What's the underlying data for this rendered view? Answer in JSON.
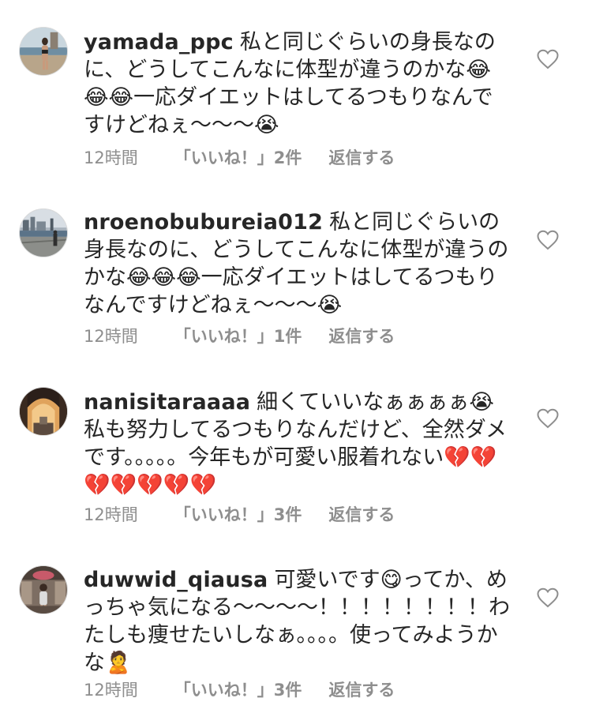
{
  "comments": [
    {
      "username": "yamada_ppc",
      "text": "私と同じぐらいの身長なのに、どうしてこんなに体型が違うのかな😂😂😂一応ダイエットはしてるつもりなんですけどねぇ〜〜〜😭",
      "time": "12時間",
      "likes": "「いいね！」2件",
      "reply": "返信する",
      "avatar_icon": "avatar-photo-beach"
    },
    {
      "username": "nroenobubureia012",
      "text": "私と同じぐらいの身長なのに、どうしてこんなに体型が違うのかな😂😂😂一応ダイエットはしてるつもりなんですけどねぇ〜〜〜😭",
      "time": "12時間",
      "likes": "「いいね！」1件",
      "reply": "返信する",
      "avatar_icon": "avatar-photo-harbor"
    },
    {
      "username": "nanisitaraaaa",
      "text": "細くていいなぁぁぁぁ😭私も努力してるつもりなんだけど、全然ダメです。。。。。今年もが可愛い服着れない💔💔💔💔💔💔💔",
      "time": "12時間",
      "likes": "「いいね！」3件",
      "reply": "返信する",
      "avatar_icon": "avatar-photo-archway"
    },
    {
      "username": "duwwid_qiausa",
      "text": "可愛いです😋ってか、めっちゃ気になる〜〜〜〜！！！！！！！！わたしも痩せたいしなぁ。。。。使ってみようかな🙎",
      "time": "12時間",
      "likes": "「いいね！」3件",
      "reply": "返信する",
      "avatar_icon": "avatar-photo-shop"
    }
  ],
  "icons": {
    "like": "heart-outline-icon"
  },
  "colors": {
    "text": "#262626",
    "meta": "#8e8e8e",
    "heart": "#8e8e8e"
  }
}
